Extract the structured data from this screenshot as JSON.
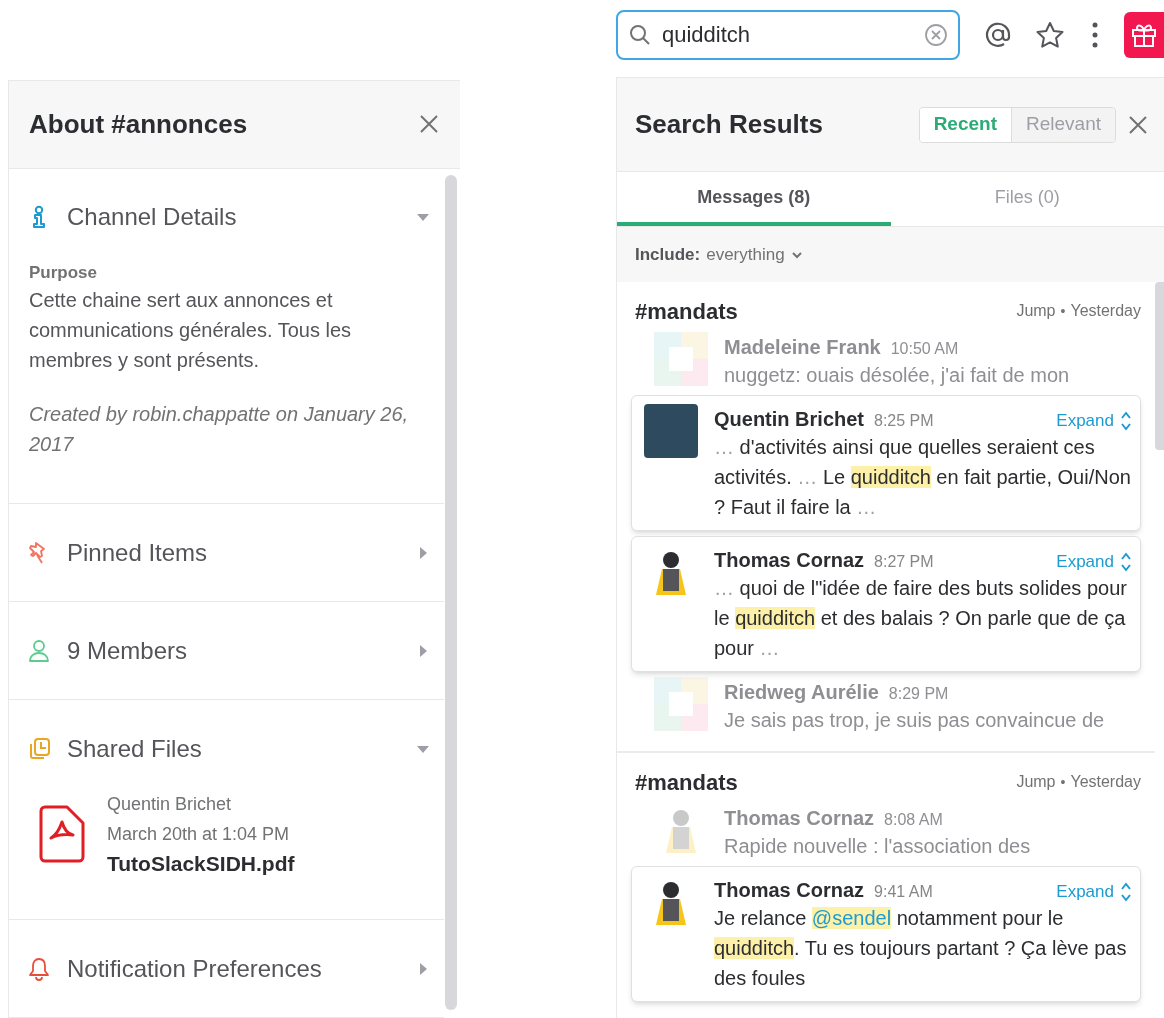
{
  "left_panel": {
    "title": "About #annonces",
    "sections": [
      {
        "kind": "details",
        "label": "Channel Details",
        "expanded": true,
        "purpose_label": "Purpose",
        "purpose": "Cette chaine sert aux annonces et communications générales. Tous les membres y sont présents.",
        "created": "Created by robin.chappatte on January 26, 2017"
      },
      {
        "kind": "pinned",
        "label": "Pinned Items",
        "expanded": false
      },
      {
        "kind": "members",
        "label": "9 Members",
        "expanded": false
      },
      {
        "kind": "files",
        "label": "Shared Files",
        "expanded": true,
        "files": [
          {
            "author": "Quentin Brichet",
            "date": "March 20th at 1:04 PM",
            "name": "TutoSlackSIDH.pdf"
          }
        ]
      },
      {
        "kind": "notifications",
        "label": "Notification Preferences",
        "expanded": false
      }
    ]
  },
  "search": {
    "value": "quidditch"
  },
  "search_panel": {
    "title": "Search Results",
    "sort": [
      {
        "label": "Recent",
        "selected": true
      },
      {
        "label": "Relevant",
        "selected": false
      }
    ],
    "tabs": [
      {
        "label": "Messages (8)",
        "selected": true
      },
      {
        "label": "Files (0)",
        "selected": false
      }
    ],
    "filter": {
      "label": "Include:",
      "value": "everything"
    },
    "groups": [
      {
        "channel": "#mandats",
        "jump": "Jump",
        "separator": "•",
        "date": "Yesterday",
        "messages": [
          {
            "kind": "context",
            "avatar": {
              "kind": "identicon"
            },
            "author": "Madeleine Frank",
            "time": "10:50 AM",
            "text": [
              {
                "kind": "plain",
                "text": "nuggetz: ouais désolée, j'ai fait de mon"
              }
            ]
          },
          {
            "kind": "match",
            "avatar": {
              "kind": "photo"
            },
            "author": "Quentin Brichet",
            "time": "8:25 PM",
            "expand": "Expand",
            "text": [
              {
                "kind": "muted",
                "text": "… "
              },
              {
                "kind": "plain",
                "text": "d'activités ainsi que quelles seraient ces activités. "
              },
              {
                "kind": "muted",
                "text": "… "
              },
              {
                "kind": "plain",
                "text": "Le "
              },
              {
                "kind": "highlight",
                "text": "quidditch"
              },
              {
                "kind": "plain",
                "text": " en fait partie, Oui/Non ? Faut il faire la "
              },
              {
                "kind": "muted",
                "text": "…"
              }
            ]
          },
          {
            "kind": "match",
            "avatar": {
              "kind": "character"
            },
            "author": "Thomas Cornaz",
            "time": "8:27 PM",
            "expand": "Expand",
            "text": [
              {
                "kind": "muted",
                "text": "… "
              },
              {
                "kind": "plain",
                "text": "quoi de l\"idée de faire des buts solides pour le "
              },
              {
                "kind": "highlight",
                "text": "quidditch"
              },
              {
                "kind": "plain",
                "text": " et des balais ? On parle que de ça pour "
              },
              {
                "kind": "muted",
                "text": "…"
              }
            ]
          },
          {
            "kind": "context",
            "avatar": {
              "kind": "identicon"
            },
            "author": "Riedweg Aurélie",
            "time": "8:29 PM",
            "text": [
              {
                "kind": "plain",
                "text": "Je sais pas trop, je suis pas convaincue de"
              }
            ]
          }
        ]
      },
      {
        "channel": "#mandats",
        "jump": "Jump",
        "separator": "•",
        "date": "Yesterday",
        "messages": [
          {
            "kind": "context",
            "avatar": {
              "kind": "character"
            },
            "author": "Thomas Cornaz",
            "time": "8:08 AM",
            "text": [
              {
                "kind": "plain",
                "text": "Rapide nouvelle : l'association des"
              }
            ]
          },
          {
            "kind": "match",
            "avatar": {
              "kind": "character"
            },
            "author": "Thomas Cornaz",
            "time": "9:41 AM",
            "expand": "Expand",
            "text": [
              {
                "kind": "plain",
                "text": "Je relance "
              },
              {
                "kind": "mention",
                "text": "@sendel"
              },
              {
                "kind": "plain",
                "text": "  notamment pour le "
              },
              {
                "kind": "highlight",
                "text": "quidditch"
              },
              {
                "kind": "plain",
                "text": ". Tu es toujours partant ? Ça lève pas des foules"
              }
            ]
          }
        ]
      }
    ]
  }
}
